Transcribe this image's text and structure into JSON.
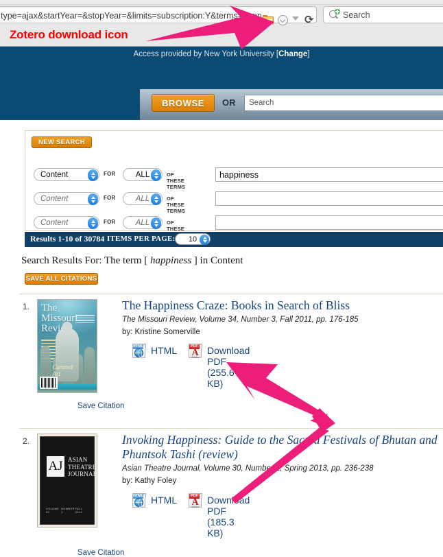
{
  "browser": {
    "url": "type=ajax&startYear=&stopYear=&limits=subscription:Y&terms=happiness",
    "zotero_icon": "zotero-folder-icon",
    "reader_icon": "reader-mode-icon",
    "dropdown_icon": "chevron-down-icon",
    "reload_icon": "⟳",
    "search_icon": "search-magnifier-icon",
    "search_placeholder": "Search"
  },
  "annotation": {
    "zotero_label": "Zotero download icon",
    "label_color": "#fe0000",
    "arrow_color": "#ed1e79"
  },
  "access": {
    "text_before": "Access provided by New York University [",
    "change_link": "Change",
    "text_after": "]"
  },
  "header": {
    "browse_label": "BROWSE",
    "or_label": "OR",
    "search_placeholder": "Search"
  },
  "search_form": {
    "new_search_label": "NEW SEARCH",
    "for_label": "FOR",
    "terms_label": "OF THESE TERMS",
    "rows": [
      {
        "field": "Content",
        "match": "ALL",
        "term": "happiness"
      },
      {
        "field": "Content",
        "match": "ALL",
        "term": ""
      },
      {
        "field": "Content",
        "match": "ALL",
        "term": ""
      }
    ]
  },
  "results_bar": {
    "count_text": "Results 1-10 of 30784",
    "items_per_page_label": "ITEMS PER PAGE:",
    "items_per_page_value": "10"
  },
  "results_header": {
    "prefix": "Search Results For: The term [ ",
    "term": "happiness",
    "suffix": " ] in Content",
    "save_all_label": "SAVE ALL CITATIONS"
  },
  "results": [
    {
      "number": "1.",
      "title": "The Happiness Craze: Books in Search of Bliss",
      "title_italic": false,
      "citation": "The Missouri Review, Volume 34, Number 3, Fall 2011, pp. 176-185",
      "author": "by: Kristine Somerville",
      "html_label": "HTML",
      "pdf_label": "Download PDF (255.6 KB)",
      "save_citation_label": "Save Citation",
      "cover": {
        "kind": "missouri-review",
        "title": "The Missouri Review",
        "script": "Curated Art"
      }
    },
    {
      "number": "2.",
      "title": "Invoking Happiness: Guide to the Sacred Festivals of Bhutan and Phuntsok Tashi (review)",
      "title_italic": true,
      "citation": "Asian Theatre Journal, Volume 30, Number 1, Spring 2013, pp. 236-238",
      "author": "by: Kathy Foley",
      "html_label": "HTML",
      "pdf_label": "Download PDF (185.3 KB)",
      "save_citation_label": "Save Citation",
      "cover": {
        "kind": "asian-theatre-journal",
        "monogram": "AJ",
        "line1": "ASIAN",
        "line2": "THEATRE",
        "line3": "JOURNAL",
        "foot_left": "VOLUME 32",
        "foot_mid": "NUMBER 2",
        "foot_right": "FALL 2014"
      }
    }
  ]
}
